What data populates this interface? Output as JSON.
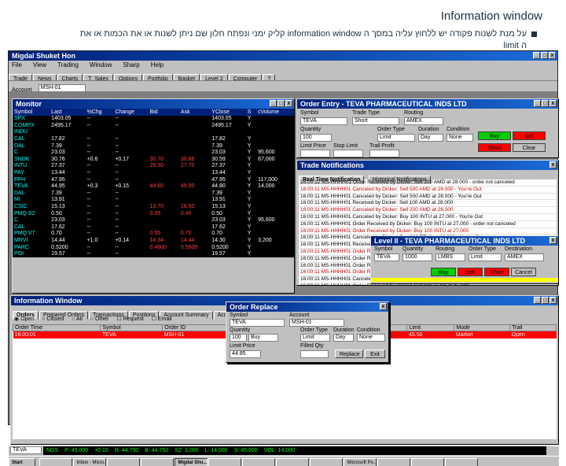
{
  "slide": {
    "title": "Information window",
    "bullet_text": "על מנת לשנות פקודה יש ללחוץ עליה במסך ה information window קליק ימני ונפתח חלון שם ניתן לשנות או את הכמות או את ה limit"
  },
  "app": {
    "title": "Migdal Shuket Hon",
    "menu": [
      "File",
      "View",
      "Trading",
      "Window",
      "Sharp",
      "Help"
    ],
    "toolbar": [
      "Trade",
      "News",
      "Charts",
      "T_Sales",
      "Options",
      "Portfolio",
      "Basket",
      "Level 2",
      "Computer",
      "?"
    ],
    "account_label": "Account",
    "account_value": "MSH-01"
  },
  "monitor": {
    "title": "Monitor",
    "columns": [
      "Symbol",
      "Last",
      "%Chg",
      "Change",
      "Bid",
      "Ask",
      "YClose",
      "S",
      "cVolume"
    ],
    "rows": [
      [
        "SPX",
        "1403.05",
        "--",
        "--",
        "",
        "",
        "1403.05",
        "Y",
        ""
      ],
      [
        "COMPX",
        "2495.17",
        "--",
        "--",
        "",
        "",
        "2495.17",
        "Y",
        ""
      ],
      [
        "INDU",
        "",
        "",
        "",
        "",
        "",
        "",
        "",
        ""
      ],
      [
        "CAL",
        "17.82",
        "--",
        "--",
        "",
        "",
        "17.82",
        "Y",
        ""
      ],
      [
        "DAL",
        "7.39",
        "--",
        "--",
        "",
        "",
        "7.39",
        "Y",
        ""
      ],
      [
        "C",
        "23.03",
        "--",
        "--",
        "",
        "",
        "23.03",
        "Y",
        "95,600"
      ],
      [
        "SNDK",
        "30.76",
        "+0.6",
        "+0.17",
        "30.70",
        "30.86",
        "30.59",
        "Y",
        "67,000"
      ],
      [
        "INTU",
        "27.37",
        "--",
        "--",
        "26.50",
        "27.70",
        "27.37",
        "Y",
        ""
      ],
      [
        "PAY",
        "13.44",
        "--",
        "--",
        "",
        "",
        "13.44",
        "Y",
        ""
      ],
      [
        "EFH",
        "47.95",
        "--",
        "--",
        "",
        "",
        "47.95",
        "Y",
        "117,000"
      ],
      [
        "TEVA",
        "44.95",
        "+0.3",
        "+0.15",
        "44.65",
        "45.00",
        "44.80",
        "Y",
        "14,000"
      ],
      [
        "DAL",
        "7.39",
        "--",
        "--",
        "",
        "",
        "7.39",
        "Y",
        ""
      ],
      [
        "MI",
        "13.91",
        "--",
        "--",
        "",
        "",
        "13.91",
        "Y",
        ""
      ],
      [
        "CSIC",
        "15.13",
        "--",
        "--",
        "13.70",
        "16.50",
        "15.13",
        "Y",
        ""
      ],
      [
        "PMQ S2",
        "0.50",
        "--",
        "--",
        "0.35",
        "0.45",
        "0.50",
        "Y",
        ""
      ],
      [
        "C",
        "23.03",
        "--",
        "--",
        "",
        "",
        "23.03",
        "Y",
        "95,600"
      ],
      [
        "CAL",
        "17.62",
        "--",
        "--",
        "",
        "",
        "17.62",
        "Y",
        ""
      ],
      [
        "PMQ V7",
        "0.70",
        "--",
        "--",
        "0.55",
        "0.70",
        "0.70",
        "Y",
        ""
      ],
      [
        "MRVI",
        "14.44",
        "+1.0",
        "+0.14",
        "14.34",
        "14.44",
        "14.30",
        "Y",
        "3,200"
      ],
      [
        "PARC",
        "0.5200",
        "--",
        "--",
        "0.4800",
        "0.5900",
        "0.5200",
        "Y",
        ""
      ],
      [
        "POI",
        "19.57",
        "--",
        "--",
        "",
        "",
        "19.57",
        "Y",
        ""
      ]
    ]
  },
  "order_entry": {
    "title": "Order Entry - TEVA PHARMACEUTICAL INDS LTD",
    "labels": [
      "Symbol",
      "Trade Type",
      "Routing",
      "Quantity",
      "Order Type",
      "Duration",
      "Condition",
      "Limit Price",
      "Stop Limit",
      "Trail Profit"
    ],
    "values": [
      "TEVA",
      "Short",
      "AMEX",
      "100",
      "Limit",
      "Day",
      "None"
    ],
    "buttons": [
      "Buy",
      "Sell",
      "Short",
      "Cancel",
      "Clear"
    ],
    "button_colors": [
      "#00cc00",
      "#ff0000",
      "#ff0000"
    ]
  },
  "notifications": {
    "title": "Trade Notifications",
    "tabs": [
      "Real Time Notification",
      "Historical Notifications"
    ],
    "rows": [
      "16:00:12 MS-HHHH01 Order Received by Dicker: Sell 200 AMD at 28.000 - order not canceled",
      "16:00:11 MS-HHHH01 Canceled by Dicker: Sell 500 AMD at 28.000 - You're Out",
      "16:00:11 MS-HHHH01 Canceled by Dicker: Sell 500 AMD at 28.000 - You're Out",
      "16:00:11 MS-HHHH01 Received by Dicker: Sell 100 AMD at 28.000",
      "16:00:11 MS-HHHH01 Canceled by Dicker: Sell 200 AMD at 28.000",
      "16:00:11 MS-HHHH01 Canceled by Dicker: Buy 100 INTU at 27.000 - You're Out",
      "16:00:11 MS-HHHH01 Order Received by Dicker: Buy 100 INTU at 27.000 - order not canceled",
      "16:00:11 MS-HHHH01 Order Received by Dicker: Buy 100 INTU at 27.000",
      "16:00:11 MS-HHHH01 Canceled by Dicker: Buy 200 TEVA at 44.800 - You're Out",
      "16:00:11 MS-HHHH01 Received by Dicker: Buy 100 TEVA at 44.850",
      "16:00:11 MS-HHHH01 Order Received by Dicker: Sell 100 TEVA at 45.000",
      "16:00:11 MS-HHHH01 Order Received by Dicker: Sell 100 TEVA at 45.000",
      "16:00:11 MS-HHHH01 Order Received by Dicker: Sell 100 TEVA at 45.000",
      "16:00:11 MS-HHHH01 Order Received by Dicker: Sell 100 TEVA at 45.000",
      "16:00:11 MS-HHHH01 Canceled by Dicker: Sell 100 TEVA at 45.000",
      "16:00:11 MS-HHHH01 Order Received by Dicker: Sell 100 TEVA at 45.000"
    ]
  },
  "level2": {
    "title": "Level II - TEVA PHARMACEUTICAL INDS LTD",
    "symbol": "TEVA",
    "qty": "1000",
    "route": "LMBS",
    "type": "Limit",
    "dest": "AMEX",
    "labels": [
      "Symbol",
      "Quantity",
      "Routing",
      "Order Type",
      "Destination"
    ],
    "buttons": [
      "Buy",
      "Sell",
      "Short",
      "Cancel"
    ]
  },
  "info": {
    "title": "Information Window",
    "tabs": [
      "Orders",
      "Prepared Orders",
      "Transactions",
      "Positions",
      "Account Summary",
      "Account Status"
    ],
    "filters": [
      "Open",
      "Closed",
      "All",
      "Other",
      "Request",
      "Email"
    ],
    "columns": [
      "Order Time",
      "Symbol",
      "Order ID",
      "Qty",
      "Status",
      "Type",
      "Side",
      "Limit",
      "Mode",
      "Trail"
    ],
    "row": [
      "16:00:01",
      "TEVA",
      "MSH-01",
      "100",
      "Open",
      "Limit",
      "Buy",
      "45.50",
      "Market",
      "Open"
    ]
  },
  "replace": {
    "title": "Order Replace",
    "labels": [
      "Symbol",
      "Account",
      "Quantity",
      "Order Type",
      "Duration",
      "Condition",
      "Limit Price",
      "Filled Qty"
    ],
    "values": [
      "TEVA",
      "MSH-01",
      "100",
      "Buy",
      "Limit",
      "Day",
      "None",
      "44.85",
      ""
    ],
    "buttons": [
      "Replace",
      "Exit"
    ]
  },
  "status_line": {
    "symbol": "TEVA",
    "segments": [
      "NGS",
      "P: 45.000",
      "+0.15",
      "R: 44.750",
      "B: 44.750",
      "SZ: 3,000",
      "L: 14,000",
      "S: 45.000",
      "VOL: 14,000"
    ]
  },
  "taskbar": {
    "start": "Start",
    "items": [
      "",
      "Inbox - Micro...",
      "",
      "",
      "Migdal Shu...",
      "",
      "",
      "",
      "",
      "Microsoft Po...",
      "",
      "",
      ""
    ]
  }
}
